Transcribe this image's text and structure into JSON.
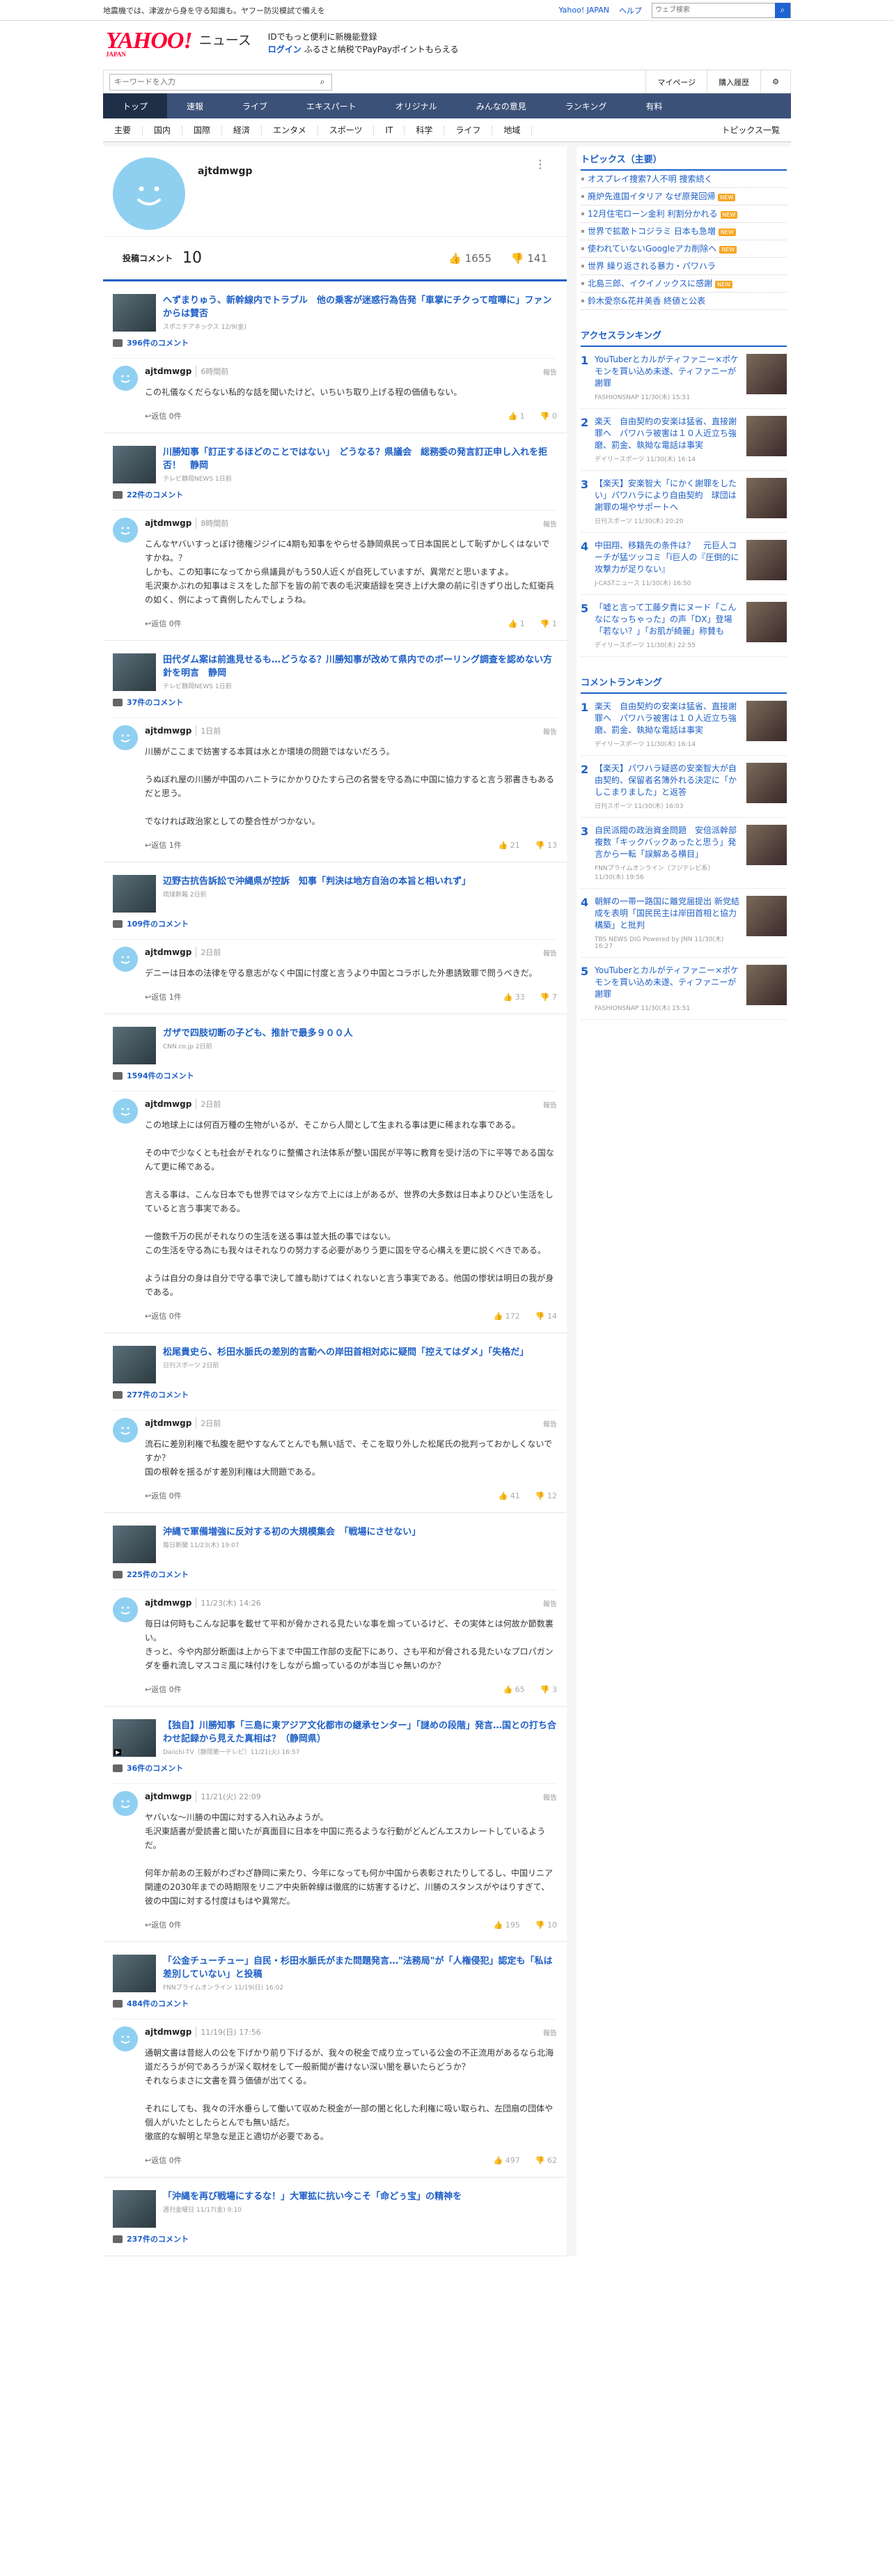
{
  "topbar": {
    "notice": "地震機では、津波から身を守る知識も。ヤフー防災模試で備えを",
    "yahoo_japan": "Yahoo! JAPAN",
    "help": "ヘルプ",
    "search_placeholder": "ウェブ検索"
  },
  "header": {
    "logo": "YAHOO!",
    "logo_sub": "JAPAN",
    "site": "ニュース",
    "promo1": "IDでもっと便利に新機能登録",
    "promo2_link": "ログイン",
    "promo2": "ふるさと納税でPayPayポイントもらえる"
  },
  "subnav": {
    "keyword_placeholder": "キーワードを入力",
    "mypage": "マイページ",
    "history": "購入履歴"
  },
  "mainnav": [
    "トップ",
    "速報",
    "ライブ",
    "エキスパート",
    "オリジナル",
    "みんなの意見",
    "ランキング",
    "有料"
  ],
  "catnav": [
    "主要",
    "国内",
    "国際",
    "経済",
    "エンタメ",
    "スポーツ",
    "IT",
    "科学",
    "ライフ",
    "地域"
  ],
  "catnav_all": "トピックス一覧",
  "profile": {
    "name": "ajtdmwgp",
    "comment_label": "投稿コメント",
    "comment_count": "10",
    "likes": "1655",
    "dislikes": "141"
  },
  "items": [
    {
      "title": "へずまりゅう、新幹線内でトラブル　他の乗客が迷惑行為告発「車掌にチクって喧嘩に」ファンからは賛否",
      "meta": "スポニチアネックス 12/9(金)",
      "count": "396件のコメント",
      "time": "6時間前",
      "text": "この礼儀なくだらない私的な話を聞いたけど、いちいち取り上げる程の価値もない。",
      "likes": "1",
      "dislikes": "0"
    },
    {
      "title": "川勝知事「訂正するほどのことではない」　どうなる？県議会　総務委の発言訂正申し入れを拒否！　静岡",
      "meta": "テレビ静岡NEWS 1日前",
      "count": "22件のコメント",
      "time": "8時間前",
      "text": "こんなヤバいすっとぼけ徳権ジジイに4期も知事をやらせる静岡県民って日本国民として恥ずかしくはないですかね。？\nしかも、この知事になってから県議員がもう50人近くが自死していますが、異常だと思いますよ。\n毛沢東かぶれの知事はミスをした部下を皆の前で表の毛沢東語録を突き上げ大衆の前に引きずり出した紅衛兵の如く、例によって責例したんでしょうね。",
      "likes": "1",
      "dislikes": "1"
    },
    {
      "title": "田代ダム案は前進見せるも…どうなる？川勝知事が改めて県内でのボーリング調査を認めない方針を明言　静岡",
      "meta": "テレビ静岡NEWS 1日前",
      "count": "37件のコメント",
      "time": "1日前",
      "text": "川勝がここまで妨害する本質は水とか環境の問題ではないだろう。\n\nうぬぼれ屋の川勝が中国のハニトラにかかりひたすら己の名誉を守る為に中国に協力すると言う邪書きもあるだと思う。\n\nでなければ政治家としての整合性がつかない。",
      "likes": "21",
      "dislikes": "13"
    },
    {
      "title": "辺野古抗告訴訟で沖縄県が控訴　知事「判決は地方自治の本旨と相いれず」",
      "meta": "琉球新報 2日前",
      "count": "109件のコメント",
      "time": "2日前",
      "text": "デニーは日本の法律を守る意志がなく中国に忖度と言うより中国とコラボした外患誘致罪で問うべきだ。",
      "likes": "33",
      "dislikes": "7"
    },
    {
      "title": "ガザで四肢切断の子ども、推計で最多９００人",
      "meta": "CNN.co.jp 2日前",
      "count": "1594件のコメント",
      "time": "2日前",
      "text": "この地球上には何百万種の生物がいるが、そこから人間として生まれる事は更に稀まれな事である。\n\nその中で少なくとも社会がそれなりに整備され法体系が整い国民が平等に教育を受け活の下に平等である国なんて更に稀である。\n\n言える事は、こんな日本でも世界ではマシな方で上には上があるが、世界の大多数は日本よりひどい生活をしていると言う事実である。\n\n一億数千万の民がそれなりの生活を送る事は並大抵の事ではない。\nこの生活を守る為にも我々はそれなりの努力する必要がありう更に国を守る心構えを更に説くべきである。\n\nようは自分の身は自分で守る事で決して誰も助けてはくれないと言う事実である。他国の惨状は明日の我が身である。",
      "likes": "172",
      "dislikes": "14"
    },
    {
      "title": "松尾貴史ら、杉田水脈氏の差別的言動への岸田首相対応に疑問「控えてはダメ」「失格だ」",
      "meta": "日刊スポーツ 2日前",
      "count": "277件のコメント",
      "time": "2日前",
      "text": "流石に差別利権で私腹を肥やすなんてとんでも無い話で、そこを取り外した松尾氏の批判っておかしくないですか？\n国の根幹を揺るがす差別利権は大問題である。",
      "likes": "41",
      "dislikes": "12"
    },
    {
      "title": "沖縄で軍備増強に反対する初の大規模集会　「戦場にさせない」",
      "meta": "毎日新聞 11/23(木) 19:07",
      "count": "225件のコメント",
      "time": "11/23(木) 14:26",
      "text": "毎日は何時もこんな記事を載せて平和が脅かされる見たいな事を煽っているけど、その実体とは何故か節数裏い。\nきっと、今や内部分断面は上から下まで中国工作部の支配下にあり、さも平和が脅される見たいなプロパガンダを垂れ流しマスコミ風に味付けをしながら煽っているのが本当じゃ無いのか？",
      "likes": "65",
      "dislikes": "3"
    },
    {
      "title": "【独自】川勝知事「三島に東アジア文化都市の継承センター」「謎めの段階」発言…国との打ち合わせ記録から見えた真相は？（静岡県）",
      "meta": "Daiichi-TV（静岡第一テレビ）11/21(火) 16:57",
      "count": "36件のコメント",
      "time": "11/21(火) 22:09",
      "text": "ヤバいな〜川勝の中国に対する入れ込みようが。\n毛沢東語書が愛読書と聞いたが真面目に日本を中国に売るような行動がどんどんエスカレートしているようだ。\n\n何年か前あの王毅がわざわざ静岡に来たり、今年になっても何か中国から表彰されたりしてるし、中国リニア関連の2030年までの時期限をリニア中央新幹線は徹底的に妨害するけど、川勝のスタンスがやはりすぎて、彼の中国に対する忖度はもはや異常だ。",
      "likes": "195",
      "dislikes": "10"
    },
    {
      "title": "「公金チューチュー」自民・杉田水脈氏がまた問題発言…\"法務局\"が「人権侵犯」認定も「私は差別していない」と投稿",
      "meta": "FNNプライムオンライン 11/19(日) 16:02",
      "count": "484件のコメント",
      "time": "11/19(日) 17:56",
      "text": "通朝文書は昔総人の公を下げかり前り下げるが、我々の税金で成り立っている公金の不正流用があるなら北海道だろうが何であろうが深く取材をして一般新聞が書けない深い闇を暴いたらどうか？\nそれならまさに文書を買う価値が出てくる。\n\nそれにしても、我々の汗水垂らして働いて収めた税金が一部の闇と化した利権に吸い取られ、左団扇の団体や個人がいたとしたらとんでも無い話だ。\n徹底的な解明と早急な是正と適切が必要である。",
      "likes": "497",
      "dislikes": "62"
    },
    {
      "title": "「沖縄を再び戦場にするな！」大軍拡に抗い今こそ「命どぅ宝」の精神を",
      "meta": "週刊金曜日 11/17(金) 9:10",
      "count": "237件のコメント",
      "time": "",
      "text": "",
      "likes": "",
      "dislikes": ""
    }
  ],
  "reply_label": "返信 0件",
  "reply_label1": "返信 1件",
  "report": "報告",
  "sidebar": {
    "topics_title": "トピックス（主要）",
    "topics": [
      "オスプレイ捜索7人不明 捜索続く",
      "廃炉先進国イタリア なぜ原発回帰",
      "12月住宅ローン金利 利割分かれる",
      "世界で拡散トコジラミ 日本も急増",
      "使われていないGoogleアカ削除へ",
      "世界 繰り返される暴力・パワハラ",
      "北島三郎、イクイノックスに感謝",
      "鈴木愛奈&花井美香 終値と公表"
    ],
    "access_title": "アクセスランキング",
    "access": [
      {
        "t": "YouTuberとカルがティファニー×ポケモンを買い込め未遂、ティファニーが謝罪",
        "m": "FASHIONSNAP 11/30(木) 15:51"
      },
      {
        "t": "楽天　自由契約の安楽は猛省、直接謝罪へ　パワハラ被害は１０人近立ち強磨、罰金、執拗な電話は事実",
        "m": "デイリースポーツ 11/30(木) 16:14"
      },
      {
        "t": "【楽天】安楽智大「にかく謝罪をしたい」パワハラにより自由契約　球団は謝罪の場やサポートへ",
        "m": "日刊スポーツ 11/30(木) 20:20"
      },
      {
        "t": "中田翔、移籍先の条件は？　元巨人コーチが猛ツッコミ「ï巨人の『圧倒的に攻撃力が足りない』",
        "m": "J-CASTニュース 11/30(木) 16:50"
      },
      {
        "t": "「嘘と言って工藤夕貴にヌード「こんなになっちゃった」の声「DX」登場「若ない？」「お肌が綺麗」称賛も",
        "m": "デイリースポーツ 11/30(木) 22:55"
      }
    ],
    "comment_title": "コメントランキング",
    "comments": [
      {
        "t": "楽天　自由契約の安楽は猛省、直接謝罪へ　パワハラ被害は１０人近立ち強磨、罰金、執拗な電話は事実",
        "m": "デイリースポーツ 11/30(木) 16:14"
      },
      {
        "t": "【楽天】パワハラ疑惑の安楽智大が自由契約、保留者名簿外れる決定に「かしこまりました」と返答",
        "m": "日刊スポーツ 11/30(木) 16:03"
      },
      {
        "t": "自民派閥の政治資金問題　安倍派幹部複数「キックバックあったと思う」発言から一転「誤解ある横目」",
        "m": "FNNプライムオンライン（フジテレビ系） 11/30(木) 19:56"
      },
      {
        "t": "朝鮮の一帯一路国に離党届提出 新党結成を表明「国民民主は岸田首相と協力構築」と批判",
        "m": "TBS NEWS DIG Powered by JNN 11/30(木) 16:27"
      },
      {
        "t": "YouTuberとカルがティファニー×ポケモンを買い込め未遂、ティファニーが謝罪",
        "m": "FASHIONSNAP 11/30(木) 15:51"
      }
    ]
  }
}
